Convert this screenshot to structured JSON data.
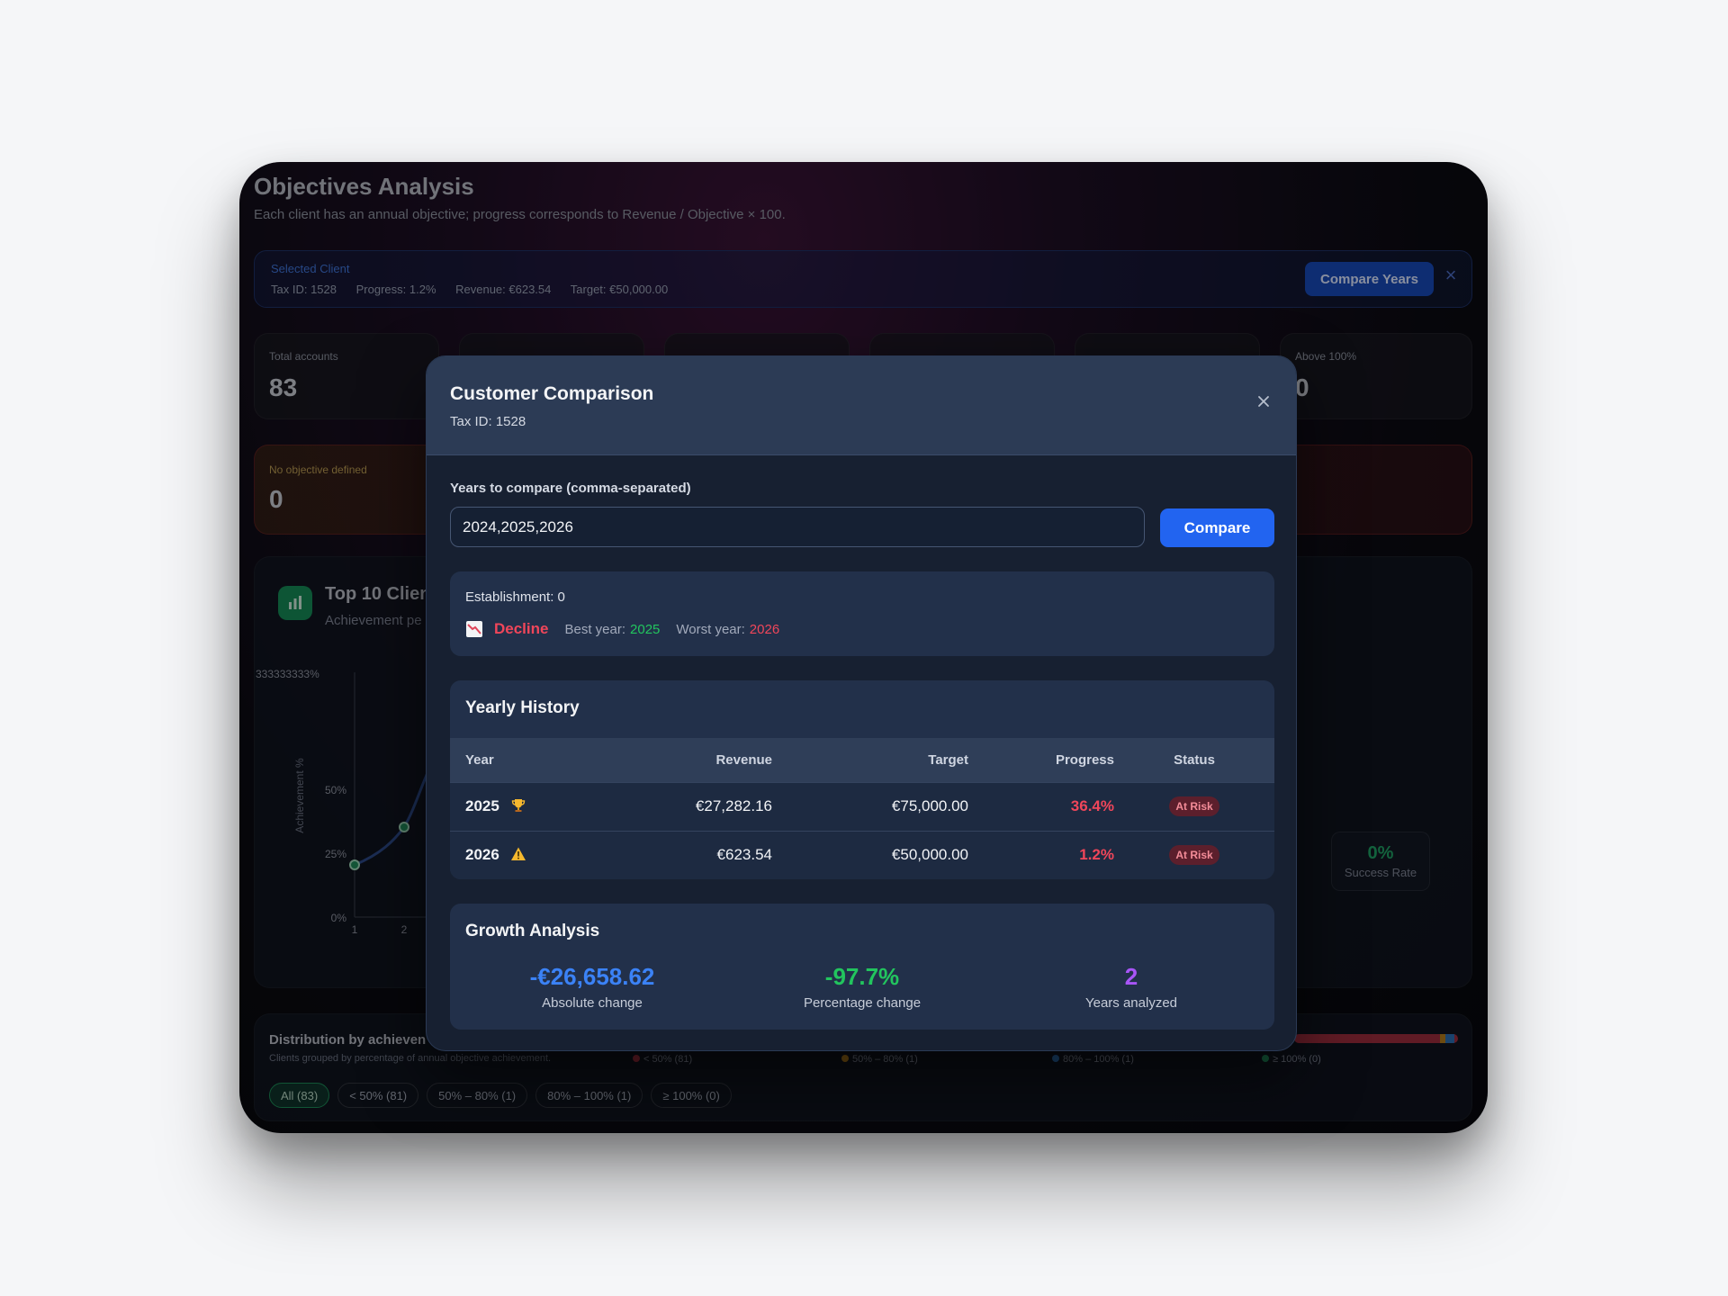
{
  "background": {
    "title": "Objectives Analysis",
    "subtitle": "Each client has an annual objective; progress corresponds to Revenue / Objective × 100.",
    "selected_client": {
      "label": "Selected Client",
      "tax_id": "Tax ID: 1528",
      "progress": "Progress: 1.2%",
      "revenue": "Revenue: €623.54",
      "target": "Target: €50,000.00",
      "compare_years_label": "Compare Years",
      "close_glyph": "×"
    },
    "stats": [
      {
        "label": "Total accounts",
        "value": "83"
      },
      {
        "label": "Above 100%",
        "value": "0"
      }
    ],
    "no_objective": {
      "label": "No objective defined",
      "value": "0"
    },
    "chart": {
      "title": "Top 10 Clien",
      "subtitle": "Achievement pe",
      "ylabel": "Achievement %",
      "top_tick": "333333333%",
      "yticks": [
        "50%",
        "25%",
        "0%"
      ],
      "xticks": [
        "1",
        "2"
      ],
      "success_value": "0%",
      "success_label": "Success Rate"
    },
    "distribution": {
      "title": "Distribution by achieven",
      "subtitle": "Clients grouped by percentage of annual objective achievement.",
      "legend": [
        {
          "label": "< 50% (81)",
          "color": "#a3303f"
        },
        {
          "label": "50% – 80% (1)",
          "color": "#b07a1a"
        },
        {
          "label": "80% – 100% (1)",
          "color": "#2b6cb0"
        },
        {
          "label": "≥ 100% (0)",
          "color": "#1f8a5a"
        }
      ],
      "filters": [
        "All (83)",
        "< 50% (81)",
        "50% – 80% (1)",
        "80% – 100% (1)",
        "≥ 100% (0)"
      ]
    }
  },
  "modal": {
    "title": "Customer Comparison",
    "tax_id": "Tax ID: 1528",
    "years_label": "Years to compare (comma-separated)",
    "years_value": "2024,2025,2026",
    "compare_label": "Compare",
    "summary": {
      "establishment": "Establishment: 0",
      "trend": "Decline",
      "best_year_label": "Best year:",
      "best_year": "2025",
      "worst_year_label": "Worst year:",
      "worst_year": "2026"
    },
    "history": {
      "title": "Yearly History",
      "columns": [
        "Year",
        "Revenue",
        "Target",
        "Progress",
        "Status"
      ],
      "rows": [
        {
          "year": "2025",
          "icon": "trophy-icon",
          "revenue": "€27,282.16",
          "target": "€75,000.00",
          "progress": "36.4%",
          "status": "At Risk"
        },
        {
          "year": "2026",
          "icon": "warning-icon",
          "revenue": "€623.54",
          "target": "€50,000.00",
          "progress": "1.2%",
          "status": "At Risk"
        }
      ]
    },
    "growth": {
      "title": "Growth Analysis",
      "absolute_change": "-€26,658.62",
      "absolute_label": "Absolute change",
      "percentage_change": "-97.7%",
      "percentage_label": "Percentage change",
      "years_analyzed": "2",
      "years_label": "Years analyzed"
    }
  },
  "colors": {
    "accent_blue": "#2264f0",
    "negative_red": "#f0465a",
    "positive_green": "#22c55e",
    "absolute_blue": "#3b82f6",
    "years_purple": "#a855f7"
  }
}
